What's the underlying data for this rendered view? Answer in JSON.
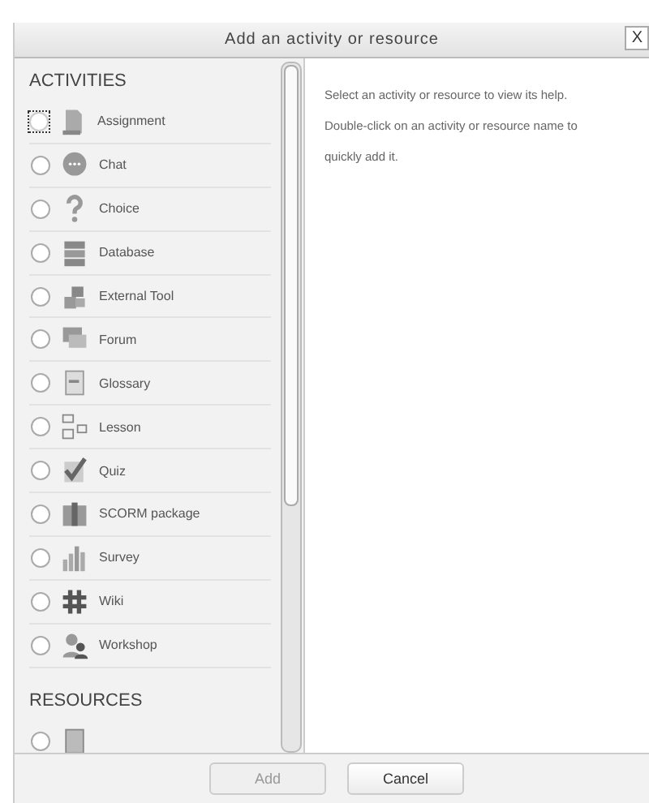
{
  "dialog": {
    "title": "Add an activity or resource",
    "close": "X"
  },
  "activities": {
    "heading": "ACTIVITIES",
    "items": [
      {
        "label": "Assignment",
        "kind": "document",
        "selected": false,
        "focused": true
      },
      {
        "label": "Chat",
        "kind": "chat",
        "selected": false
      },
      {
        "label": "Choice",
        "kind": "question",
        "selected": false
      },
      {
        "label": "Database",
        "kind": "database",
        "selected": false
      },
      {
        "label": "External Tool",
        "kind": "puzzle",
        "selected": false
      },
      {
        "label": "Forum",
        "kind": "forum",
        "selected": false
      },
      {
        "label": "Glossary",
        "kind": "book",
        "selected": false
      },
      {
        "label": "Lesson",
        "kind": "tree",
        "selected": false
      },
      {
        "label": "Quiz",
        "kind": "check",
        "selected": false
      },
      {
        "label": "SCORM package",
        "kind": "box",
        "selected": false
      },
      {
        "label": "Survey",
        "kind": "bars",
        "selected": false
      },
      {
        "label": "Wiki",
        "kind": "grid",
        "selected": false
      },
      {
        "label": "Workshop",
        "kind": "people",
        "selected": false
      }
    ]
  },
  "resources": {
    "heading": "RESOURCES",
    "items": [
      {
        "kind": "book",
        "selected": false
      }
    ]
  },
  "help": "Select an activity or resource to view its help. Double-click on an activity or resource name to quickly add it.",
  "buttons": [
    {
      "label": "Add",
      "disabled": true
    },
    {
      "label": "Cancel",
      "disabled": false
    }
  ]
}
